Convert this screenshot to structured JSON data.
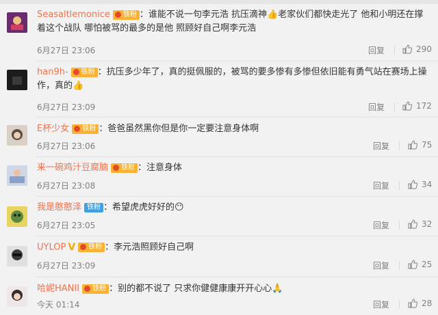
{
  "comments": [
    {
      "user": "Seasaltlemonice",
      "badge": "铁粉",
      "text": "谁能不说一句李元浩 抗压滴神👍老家伙们都快走光了 他和小明还在撑着这个战队 哪怕被骂的最多的是他 照顾好自己啊李元浩",
      "time": "6月27日 23:06",
      "reply": "回复",
      "likes": "290"
    },
    {
      "user": "han9h-",
      "badge": "铁粉",
      "text": "抗压多少年了，真的挺佩服的，被骂的要多惨有多惨但依旧能有勇气站在赛场上操作，真的👍",
      "time": "6月27日 23:09",
      "reply": "回复",
      "likes": "172"
    },
    {
      "user": "E杯少女",
      "badge": "铁粉",
      "text": "爸爸虽然黑你但是你一定要注意身体啊",
      "time": "6月27日 23:06",
      "reply": "回复",
      "likes": "75"
    },
    {
      "user": "来一碗鸡汁豆腐脑",
      "badge": "铁粉",
      "text": "注意身体",
      "time": "6月27日 23:08",
      "reply": "回复",
      "likes": "34"
    },
    {
      "user": "我是憨憨泽",
      "badge": "铁粉",
      "text": "希望虎虎好好的😶",
      "time": "6月27日 23:05",
      "reply": "回复",
      "likes": "32"
    },
    {
      "user": "UYLOP",
      "badge": "铁粉",
      "text": "李元浩照顾好自己啊",
      "time": "6月27日 23:09",
      "reply": "回复",
      "likes": "25"
    },
    {
      "user": "哈妮HANII",
      "badge": "铁粉",
      "text": "别的都不说了 只求你健健康康开开心心🙏",
      "time": "今天 01:14",
      "reply": "回复",
      "likes": "28"
    }
  ],
  "colors": {
    "username": "#eb7350",
    "badge_tie": "#43a0e0",
    "badge_fan": "#f9b233"
  },
  "icons": {
    "like": "thumbs-up-icon"
  }
}
